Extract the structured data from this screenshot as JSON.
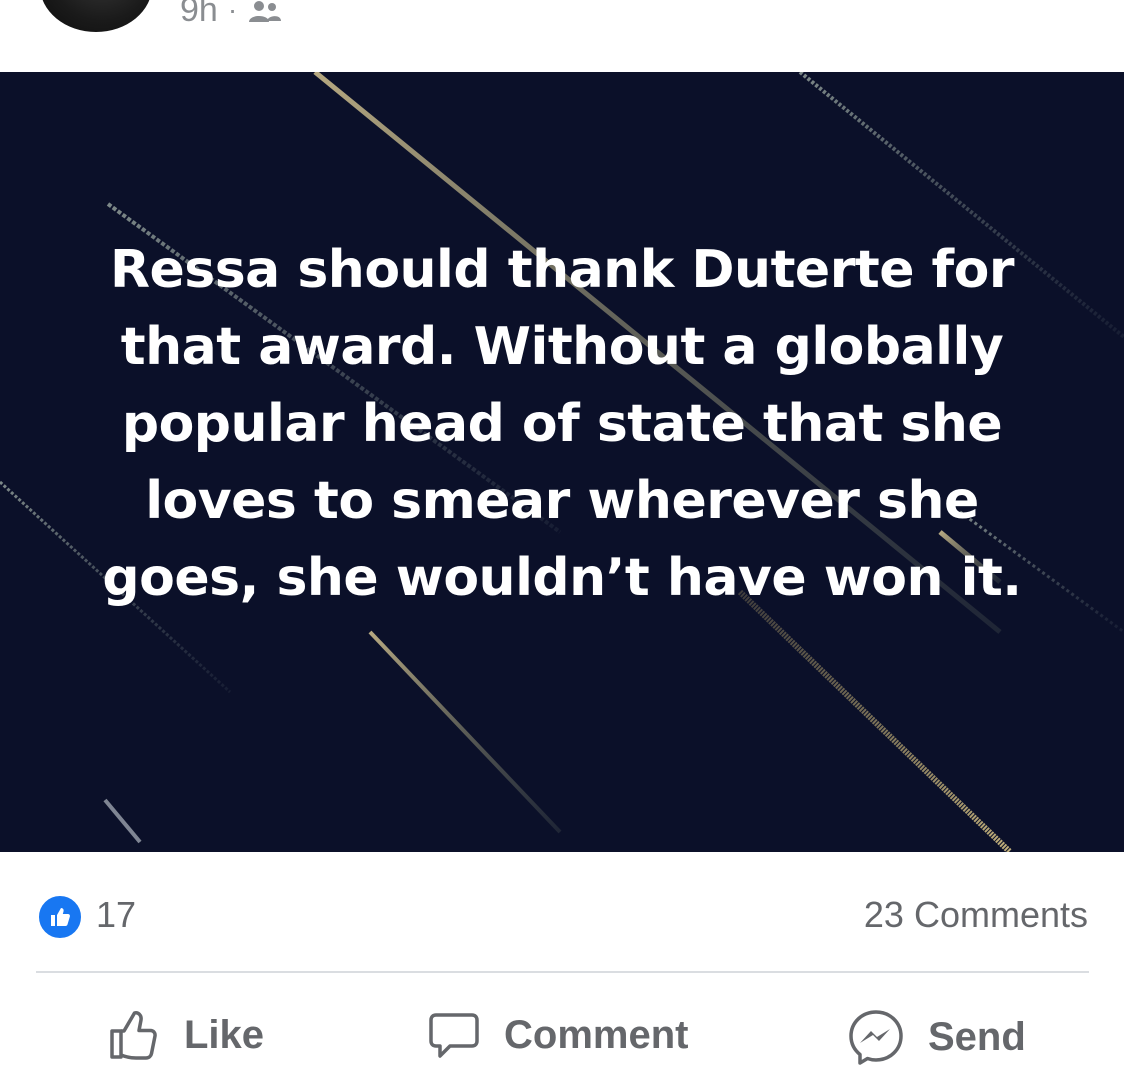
{
  "post": {
    "time": "9h",
    "separator": "·",
    "audience_icon": "friends-icon",
    "card": {
      "text": "Ressa should thank Duterte for that award. Without a globally popular head of state that she loves to smear wherever she goes, she wouldn’t have won it.",
      "background_color": "#0b1029"
    }
  },
  "reactions": {
    "like_count": "17",
    "comments": "23 Comments"
  },
  "actions": {
    "like_label": "Like",
    "comment_label": "Comment",
    "send_label": "Send"
  },
  "colors": {
    "brand_blue": "#1877f2",
    "muted_text": "#65676b",
    "meta_text": "#8a8d91"
  }
}
